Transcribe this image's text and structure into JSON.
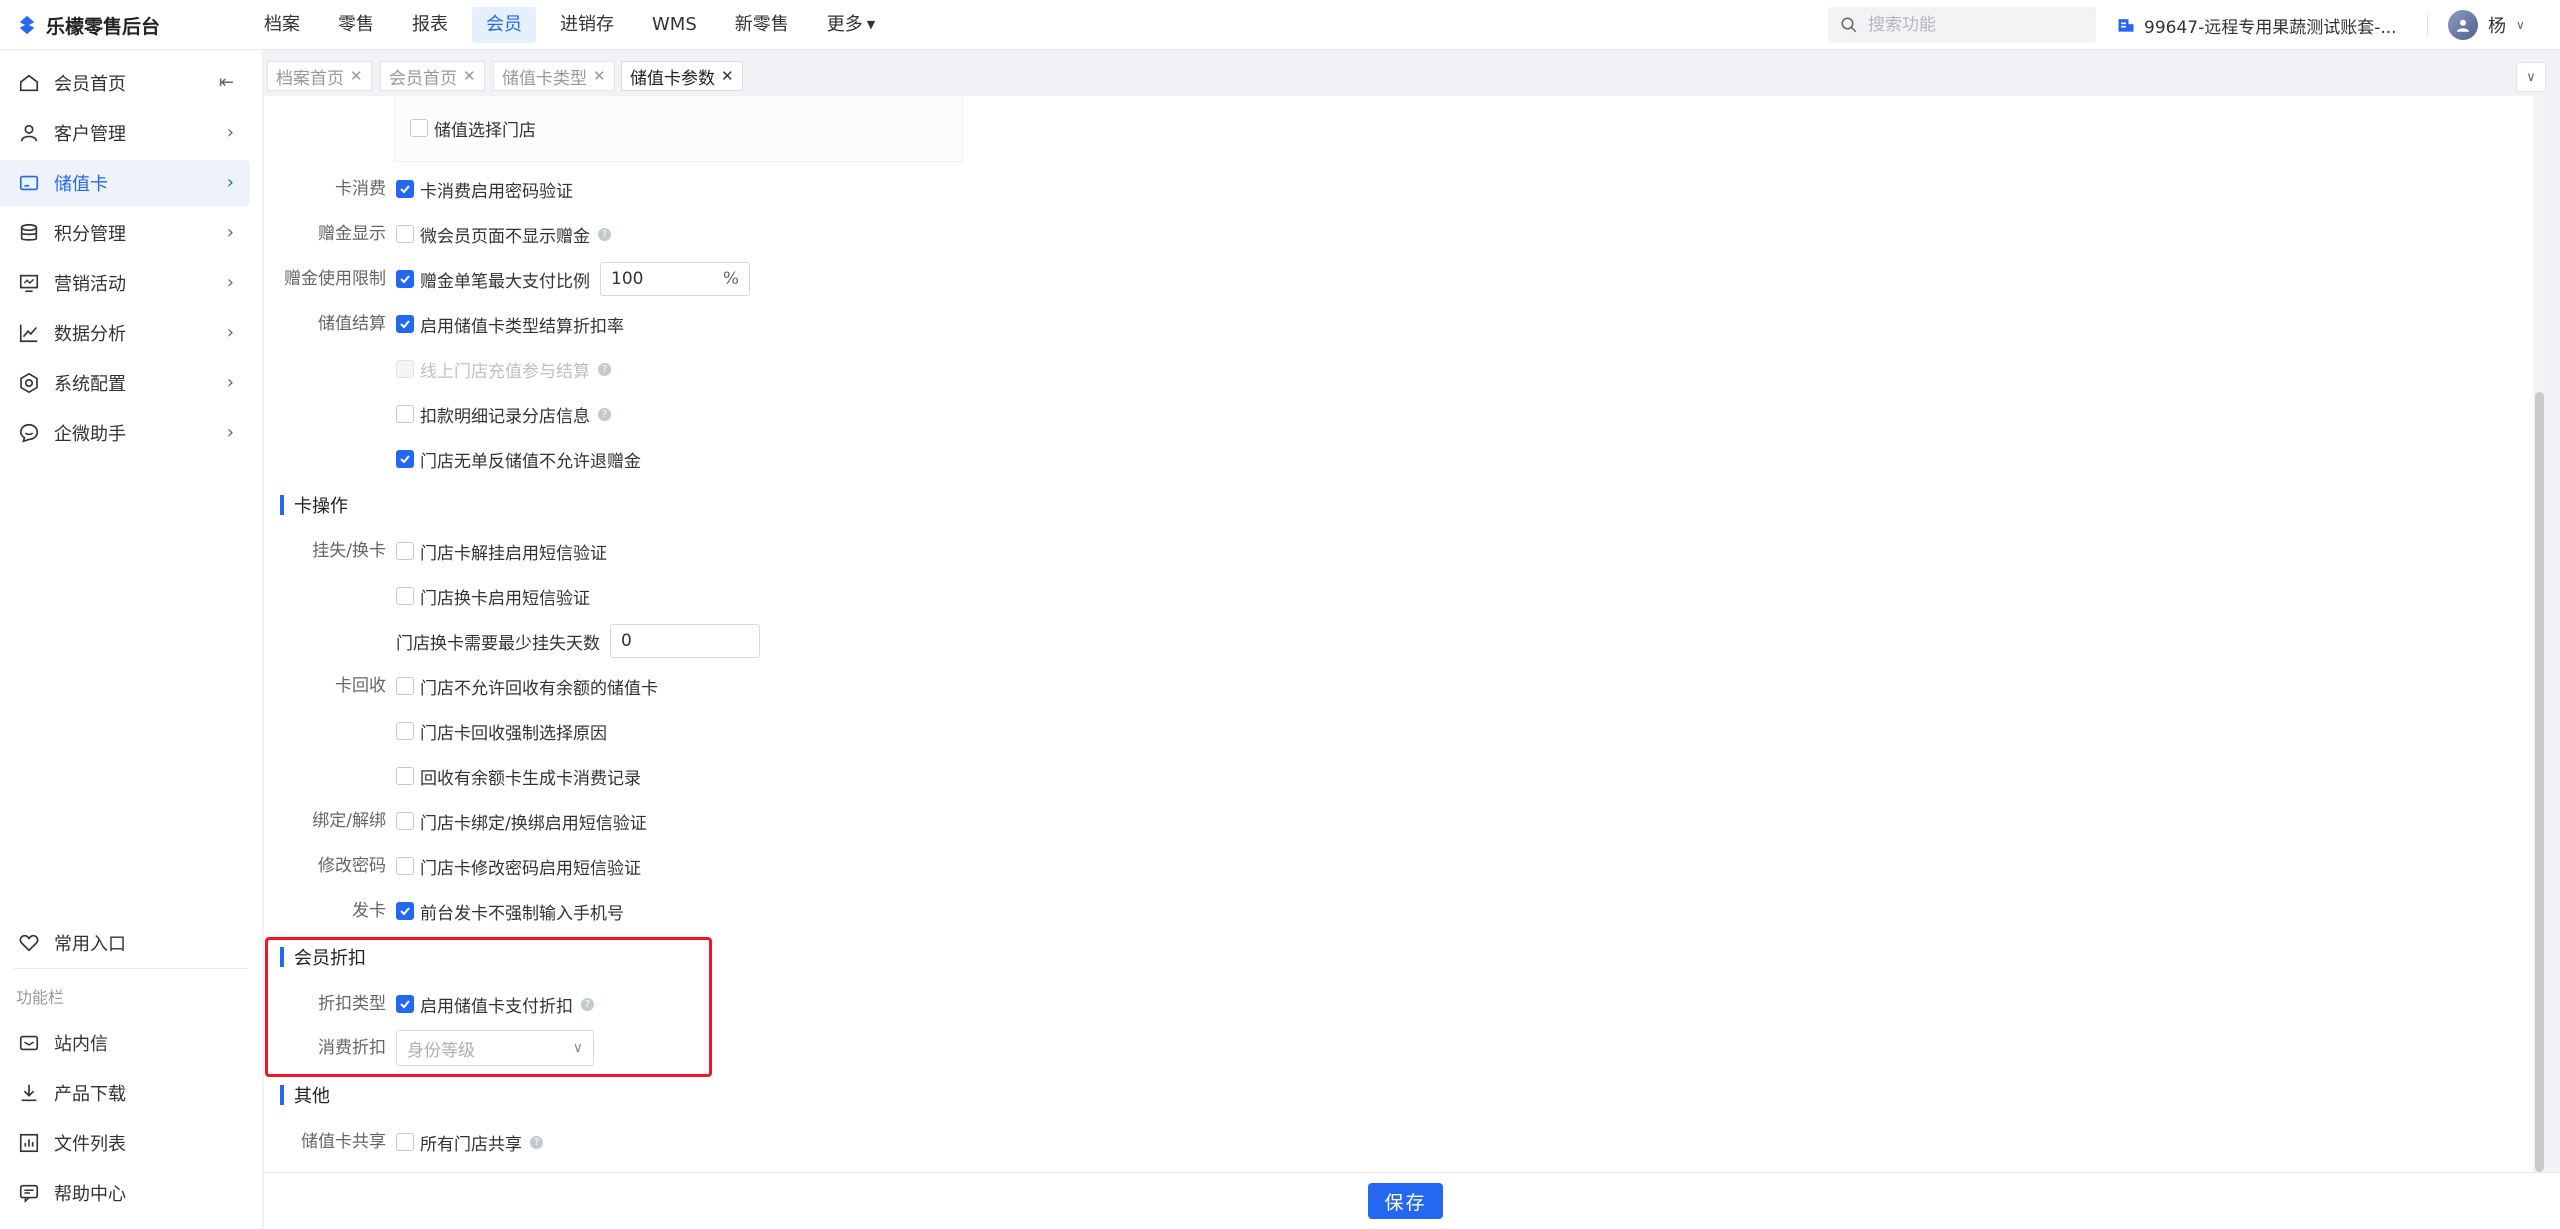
{
  "app": {
    "title": "乐檬零售后台"
  },
  "topnav": [
    {
      "label": "档案",
      "active": false
    },
    {
      "label": "零售",
      "active": false
    },
    {
      "label": "报表",
      "active": false
    },
    {
      "label": "会员",
      "active": true
    },
    {
      "label": "进销存",
      "active": false
    },
    {
      "label": "WMS",
      "active": false
    },
    {
      "label": "新零售",
      "active": false
    },
    {
      "label": "更多",
      "active": false
    }
  ],
  "search": {
    "placeholder": "搜索功能"
  },
  "account": {
    "label": "99647-远程专用果蔬测试账套-..."
  },
  "user": {
    "name": "杨"
  },
  "sidebar": {
    "items": [
      {
        "label": "会员首页"
      },
      {
        "label": "客户管理"
      },
      {
        "label": "储值卡"
      },
      {
        "label": "积分管理"
      },
      {
        "label": "营销活动"
      },
      {
        "label": "数据分析"
      },
      {
        "label": "系统配置"
      },
      {
        "label": "企微助手"
      }
    ],
    "common": "常用入口",
    "function_bar": "功能栏",
    "bottom": [
      {
        "label": "站内信"
      },
      {
        "label": "产品下载"
      },
      {
        "label": "文件列表"
      },
      {
        "label": "帮助中心"
      }
    ]
  },
  "tabs": [
    {
      "label": "档案首页"
    },
    {
      "label": "会员首页"
    },
    {
      "label": "储值卡类型"
    },
    {
      "label": "储值卡参数"
    }
  ],
  "form": {
    "store_select": "储值选择门店",
    "card_consume": {
      "label": "卡消费",
      "option": "卡消费启用密码验证",
      "checked": true
    },
    "gift_display": {
      "label": "赠金显示",
      "option": "微会员页面不显示赠金",
      "checked": false
    },
    "gift_limit": {
      "label": "赠金使用限制",
      "option": "赠金单笔最大支付比例",
      "checked": true,
      "value": "100",
      "unit": "%"
    },
    "settlement": {
      "label": "储值结算",
      "option": "启用储值卡类型结算折扣率",
      "checked": true
    },
    "online_recharge": {
      "option": "线上门店充值参与结算",
      "checked": false,
      "disabled": true
    },
    "deduct_detail": {
      "option": "扣款明细记录分店信息",
      "checked": false
    },
    "no_refund": {
      "option": "门店无单反储值不允许退赠金",
      "checked": true
    },
    "section_card_ops": "卡操作",
    "loss_replace": {
      "label": "挂失/换卡",
      "option": "门店卡解挂启用短信验证",
      "checked": false
    },
    "replace_sms": {
      "option": "门店换卡启用短信验证",
      "checked": false
    },
    "min_days": {
      "label": "门店换卡需要最少挂失天数",
      "value": "0"
    },
    "card_recycle": {
      "label": "卡回收",
      "option": "门店不允许回收有余额的储值卡",
      "checked": false
    },
    "recycle_reason": {
      "option": "门店卡回收强制选择原因",
      "checked": false
    },
    "recycle_record": {
      "option": "回收有余额卡生成卡消费记录",
      "checked": false
    },
    "bind": {
      "label": "绑定/解绑",
      "option": "门店卡绑定/换绑启用短信验证",
      "checked": false
    },
    "change_pwd": {
      "label": "修改密码",
      "option": "门店卡修改密码启用短信验证",
      "checked": false
    },
    "issue": {
      "label": "发卡",
      "option": "前台发卡不强制输入手机号",
      "checked": true
    },
    "section_discount": "会员折扣",
    "discount_type": {
      "label": "折扣类型",
      "option": "启用储值卡支付折扣",
      "checked": true
    },
    "consume_discount": {
      "label": "消费折扣",
      "placeholder": "身份等级"
    },
    "section_other": "其他",
    "card_share": {
      "label": "储值卡共享",
      "option": "所有门店共享",
      "checked": false
    }
  },
  "save_label": "保存",
  "colors": {
    "accent": "#2468f2",
    "highlight": "#f3142b"
  }
}
